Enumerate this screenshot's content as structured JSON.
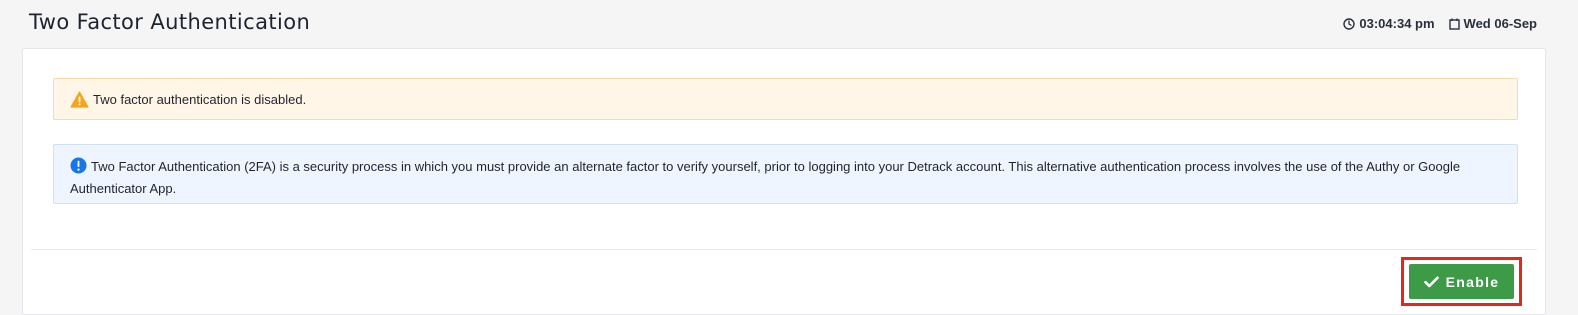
{
  "header": {
    "title": "Two Factor Authentication",
    "time": "03:04:34 pm",
    "date": "Wed 06-Sep",
    "icons": {
      "time": "clock-icon",
      "date": "calendar-icon"
    }
  },
  "alerts": {
    "warning": {
      "icon": "warning-icon",
      "text": "Two factor authentication is disabled."
    },
    "info": {
      "icon": "info-icon",
      "text": "Two Factor Authentication (2FA) is a security process in which you must provide an alternate factor to verify yourself, prior to logging into your Detrack account. This alternative authentication process involves the use of the Authy or Google Authenticator App."
    }
  },
  "footer": {
    "enable_button": {
      "label": "Enable",
      "icon": "check-icon"
    }
  },
  "colors": {
    "warning_bg": "#fff6e8",
    "warning_icon": "#f4a51c",
    "info_bg": "#eef5fe",
    "info_icon": "#1877e8",
    "button": "#3d9b48",
    "highlight": "#e02a1b"
  }
}
